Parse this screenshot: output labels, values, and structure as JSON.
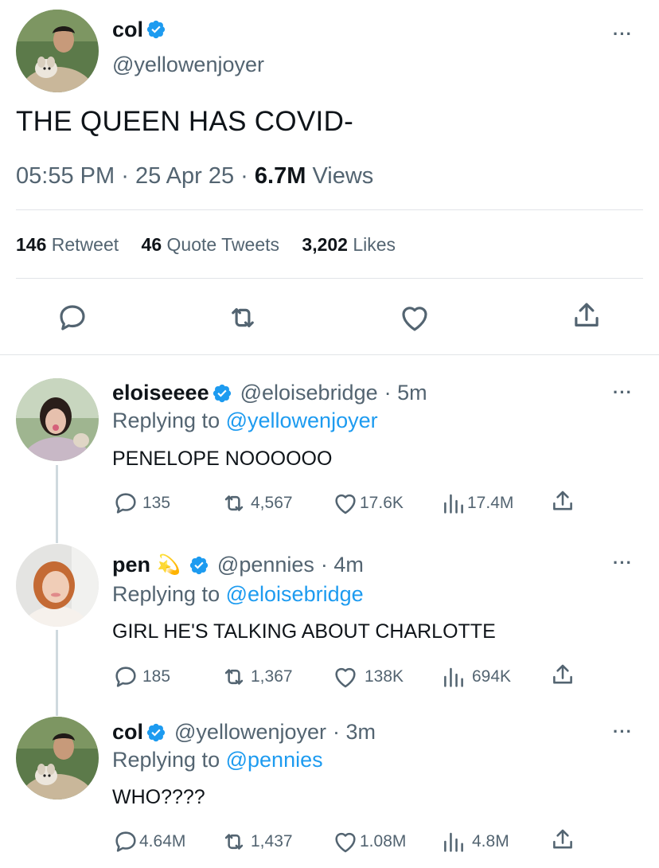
{
  "main_tweet": {
    "display_name": "col",
    "handle": "@yellowenjoyer",
    "text": "THE QUEEN HAS COVID-",
    "time": "05:55 PM",
    "date": "25 Apr 25",
    "separator": "·",
    "views_count": "6.7M",
    "views_label": "Views",
    "stats": {
      "retweets_count": "146",
      "retweets_label": "Retweet",
      "quotes_count": "46",
      "quotes_label": "Quote Tweets",
      "likes_count": "3,202",
      "likes_label": "Likes"
    },
    "more": "···"
  },
  "replies": [
    {
      "display_name": "eloiseeee",
      "handle": "@eloisebridge",
      "time": "· 5m",
      "replying_prefix": "Replying to",
      "replying_to": "@yellowenjoyer",
      "text": "PENELOPE NOOOOOO",
      "replies": "135",
      "retweets": "4,567",
      "likes": "17.6K",
      "views": "17.4M",
      "more": "···"
    },
    {
      "display_name": "pen",
      "emoji": "💫",
      "handle": "@pennies",
      "time": "· 4m",
      "replying_prefix": "Replying to",
      "replying_to": "@eloisebridge",
      "text": "GIRL HE'S TALKING ABOUT CHARLOTTE",
      "replies": "185",
      "retweets": "1,367",
      "likes": "138K",
      "views": "694K",
      "more": "···"
    },
    {
      "display_name": "col",
      "handle": "@yellowenjoyer",
      "time": "· 3m",
      "replying_prefix": "Replying to",
      "replying_to": "@pennies",
      "text": "WHO????",
      "replies": "4.64M",
      "retweets": "1,437",
      "likes": "1.08M",
      "views": "4.8M",
      "more": "···"
    }
  ],
  "icons": [
    "reply-icon",
    "retweet-icon",
    "like-icon",
    "share-icon",
    "views-icon",
    "verified-icon",
    "more-icon"
  ],
  "colors": {
    "accent": "#1d9bf0",
    "text": "#0f1419",
    "muted": "#536471",
    "divider": "#e1e4e8"
  }
}
